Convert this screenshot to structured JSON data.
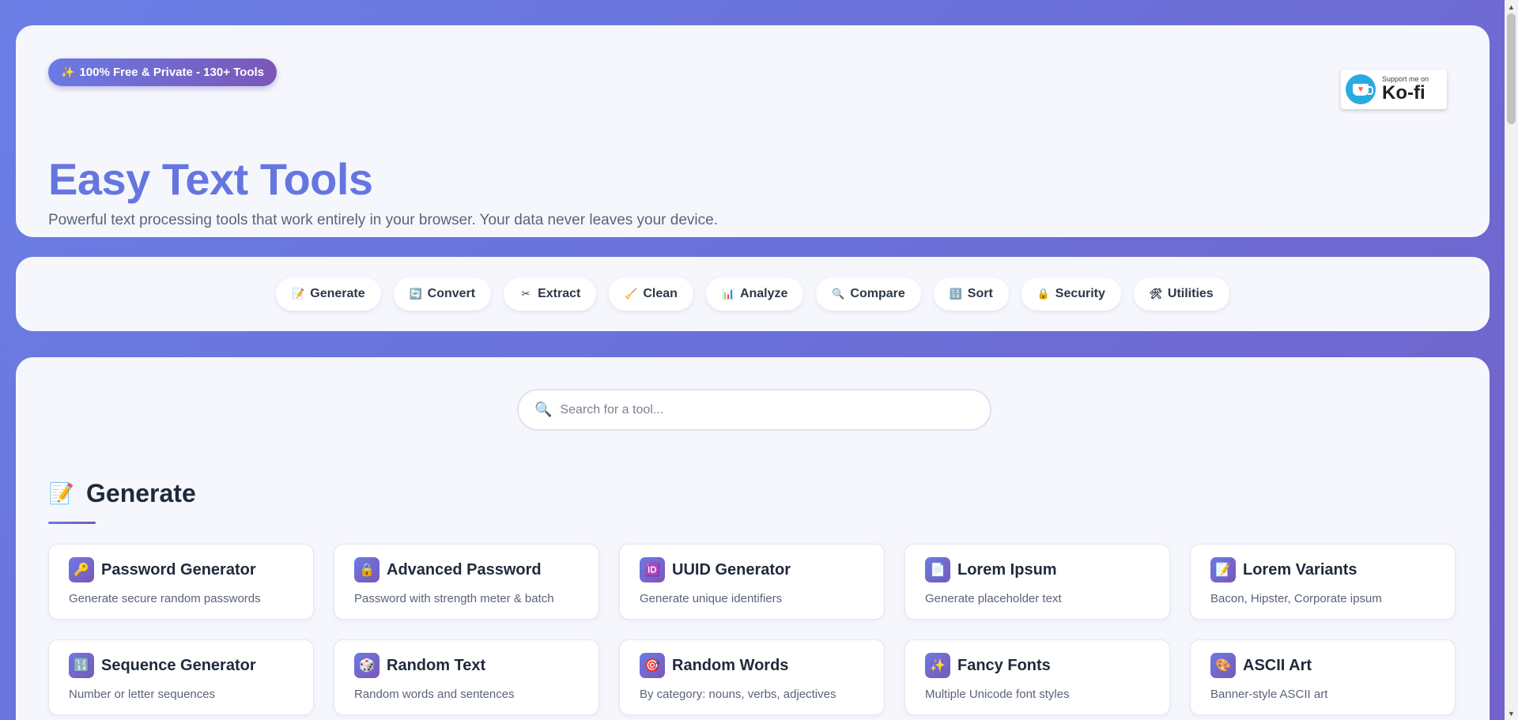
{
  "hero": {
    "badge": "100% Free & Private - 130+ Tools",
    "badge_icon": "✨",
    "title": "Easy Text Tools",
    "subtitle": "Powerful text processing tools that work entirely in your browser. Your data never leaves your device.",
    "kofi_small": "Support me on",
    "kofi_big": "Ko-fi"
  },
  "categories": [
    {
      "label": "Generate",
      "icon": "📝"
    },
    {
      "label": "Convert",
      "icon": "🔄"
    },
    {
      "label": "Extract",
      "icon": "✂"
    },
    {
      "label": "Clean",
      "icon": "🧹"
    },
    {
      "label": "Analyze",
      "icon": "📊"
    },
    {
      "label": "Compare",
      "icon": "🔍"
    },
    {
      "label": "Sort",
      "icon": "🔢"
    },
    {
      "label": "Security",
      "icon": "🔒"
    },
    {
      "label": "Utilities",
      "icon": "🛠"
    }
  ],
  "search": {
    "placeholder": "Search for a tool...",
    "icon": "🔍"
  },
  "section": {
    "title": "Generate",
    "icon": "📝"
  },
  "tools": [
    {
      "name": "Password Generator",
      "desc": "Generate secure random passwords",
      "icon": "🔑"
    },
    {
      "name": "Advanced Password",
      "desc": "Password with strength meter & batch",
      "icon": "🔒"
    },
    {
      "name": "UUID Generator",
      "desc": "Generate unique identifiers",
      "icon": "🆔"
    },
    {
      "name": "Lorem Ipsum",
      "desc": "Generate placeholder text",
      "icon": "📄"
    },
    {
      "name": "Lorem Variants",
      "desc": "Bacon, Hipster, Corporate ipsum",
      "icon": "📝"
    },
    {
      "name": "Sequence Generator",
      "desc": "Number or letter sequences",
      "icon": "🔢"
    },
    {
      "name": "Random Text",
      "desc": "Random words and sentences",
      "icon": "🎲"
    },
    {
      "name": "Random Words",
      "desc": "By category: nouns, verbs, adjectives",
      "icon": "🎯"
    },
    {
      "name": "Fancy Fonts",
      "desc": "Multiple Unicode font styles",
      "icon": "✨"
    },
    {
      "name": "ASCII Art",
      "desc": "Banner-style ASCII art",
      "icon": "🎨"
    }
  ]
}
